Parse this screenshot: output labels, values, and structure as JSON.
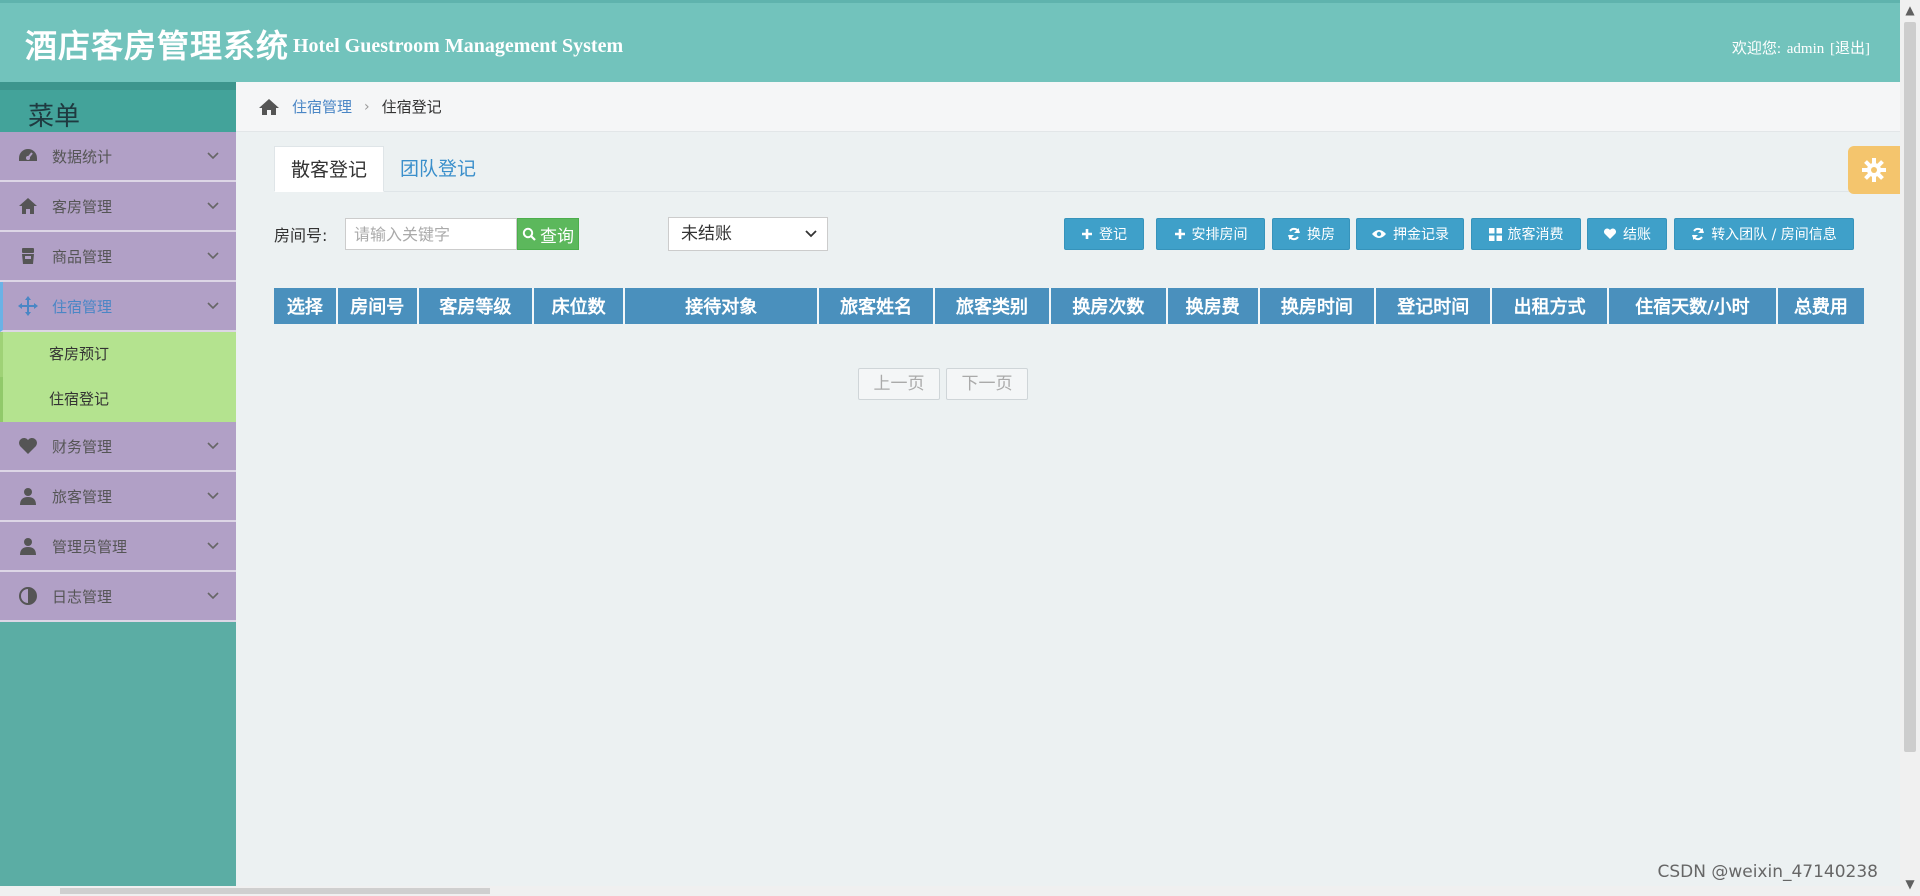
{
  "header": {
    "title_cn": "酒店客房管理系统",
    "title_en": "Hotel Guestroom Management System",
    "welcome": "欢迎您:",
    "user": "admin",
    "logout": "[退出]"
  },
  "sidebar": {
    "menu_title": "菜单",
    "items": [
      {
        "label": "数据统计",
        "icon": "dashboard-icon"
      },
      {
        "label": "客房管理",
        "icon": "home-icon"
      },
      {
        "label": "商品管理",
        "icon": "cup-icon"
      },
      {
        "label": "住宿管理",
        "icon": "move-icon",
        "active": true
      },
      {
        "label": "财务管理",
        "icon": "heart-icon"
      },
      {
        "label": "旅客管理",
        "icon": "user-icon"
      },
      {
        "label": "管理员管理",
        "icon": "user-icon"
      },
      {
        "label": "日志管理",
        "icon": "contrast-icon"
      }
    ],
    "subitems": [
      "客房预订",
      "住宿登记"
    ]
  },
  "breadcrumb": {
    "parent": "住宿管理",
    "current": "住宿登记"
  },
  "tabs": [
    "散客登记",
    "团队登记"
  ],
  "toolbar": {
    "room_label": "房间号:",
    "search_placeholder": "请输入关键字",
    "query_label": "查询",
    "status_selected": "未结账",
    "actions": [
      {
        "label": "登记",
        "icon": "plus-icon"
      },
      {
        "label": "安排房间",
        "icon": "plus-icon"
      },
      {
        "label": "换房",
        "icon": "refresh-icon"
      },
      {
        "label": "押金记录",
        "icon": "eye-icon"
      },
      {
        "label": "旅客消费",
        "icon": "grid-icon"
      },
      {
        "label": "结账",
        "icon": "heart-icon"
      },
      {
        "label": "转入团队 / 房间信息",
        "icon": "refresh-icon"
      }
    ]
  },
  "table": {
    "columns": [
      "选择",
      "房间号",
      "客房等级",
      "床位数",
      "接待对象",
      "旅客姓名",
      "旅客类别",
      "换房次数",
      "换房费",
      "换房时间",
      "登记时间",
      "出租方式",
      "住宿天数/小时",
      "总费用"
    ],
    "rows": []
  },
  "pager": {
    "prev": "上一页",
    "next": "下一页"
  },
  "watermark": "CSDN @weixin_47140238",
  "colors": {
    "header_bg": "#72c3bc",
    "sidebar_item_bg": "#b1a0c6",
    "submenu_bg": "#b4e38f",
    "table_header_bg": "#4a90bd",
    "action_button_bg": "#3fa0c9",
    "query_button_bg": "#5cb85c",
    "settings_bg": "#f4c56d"
  }
}
